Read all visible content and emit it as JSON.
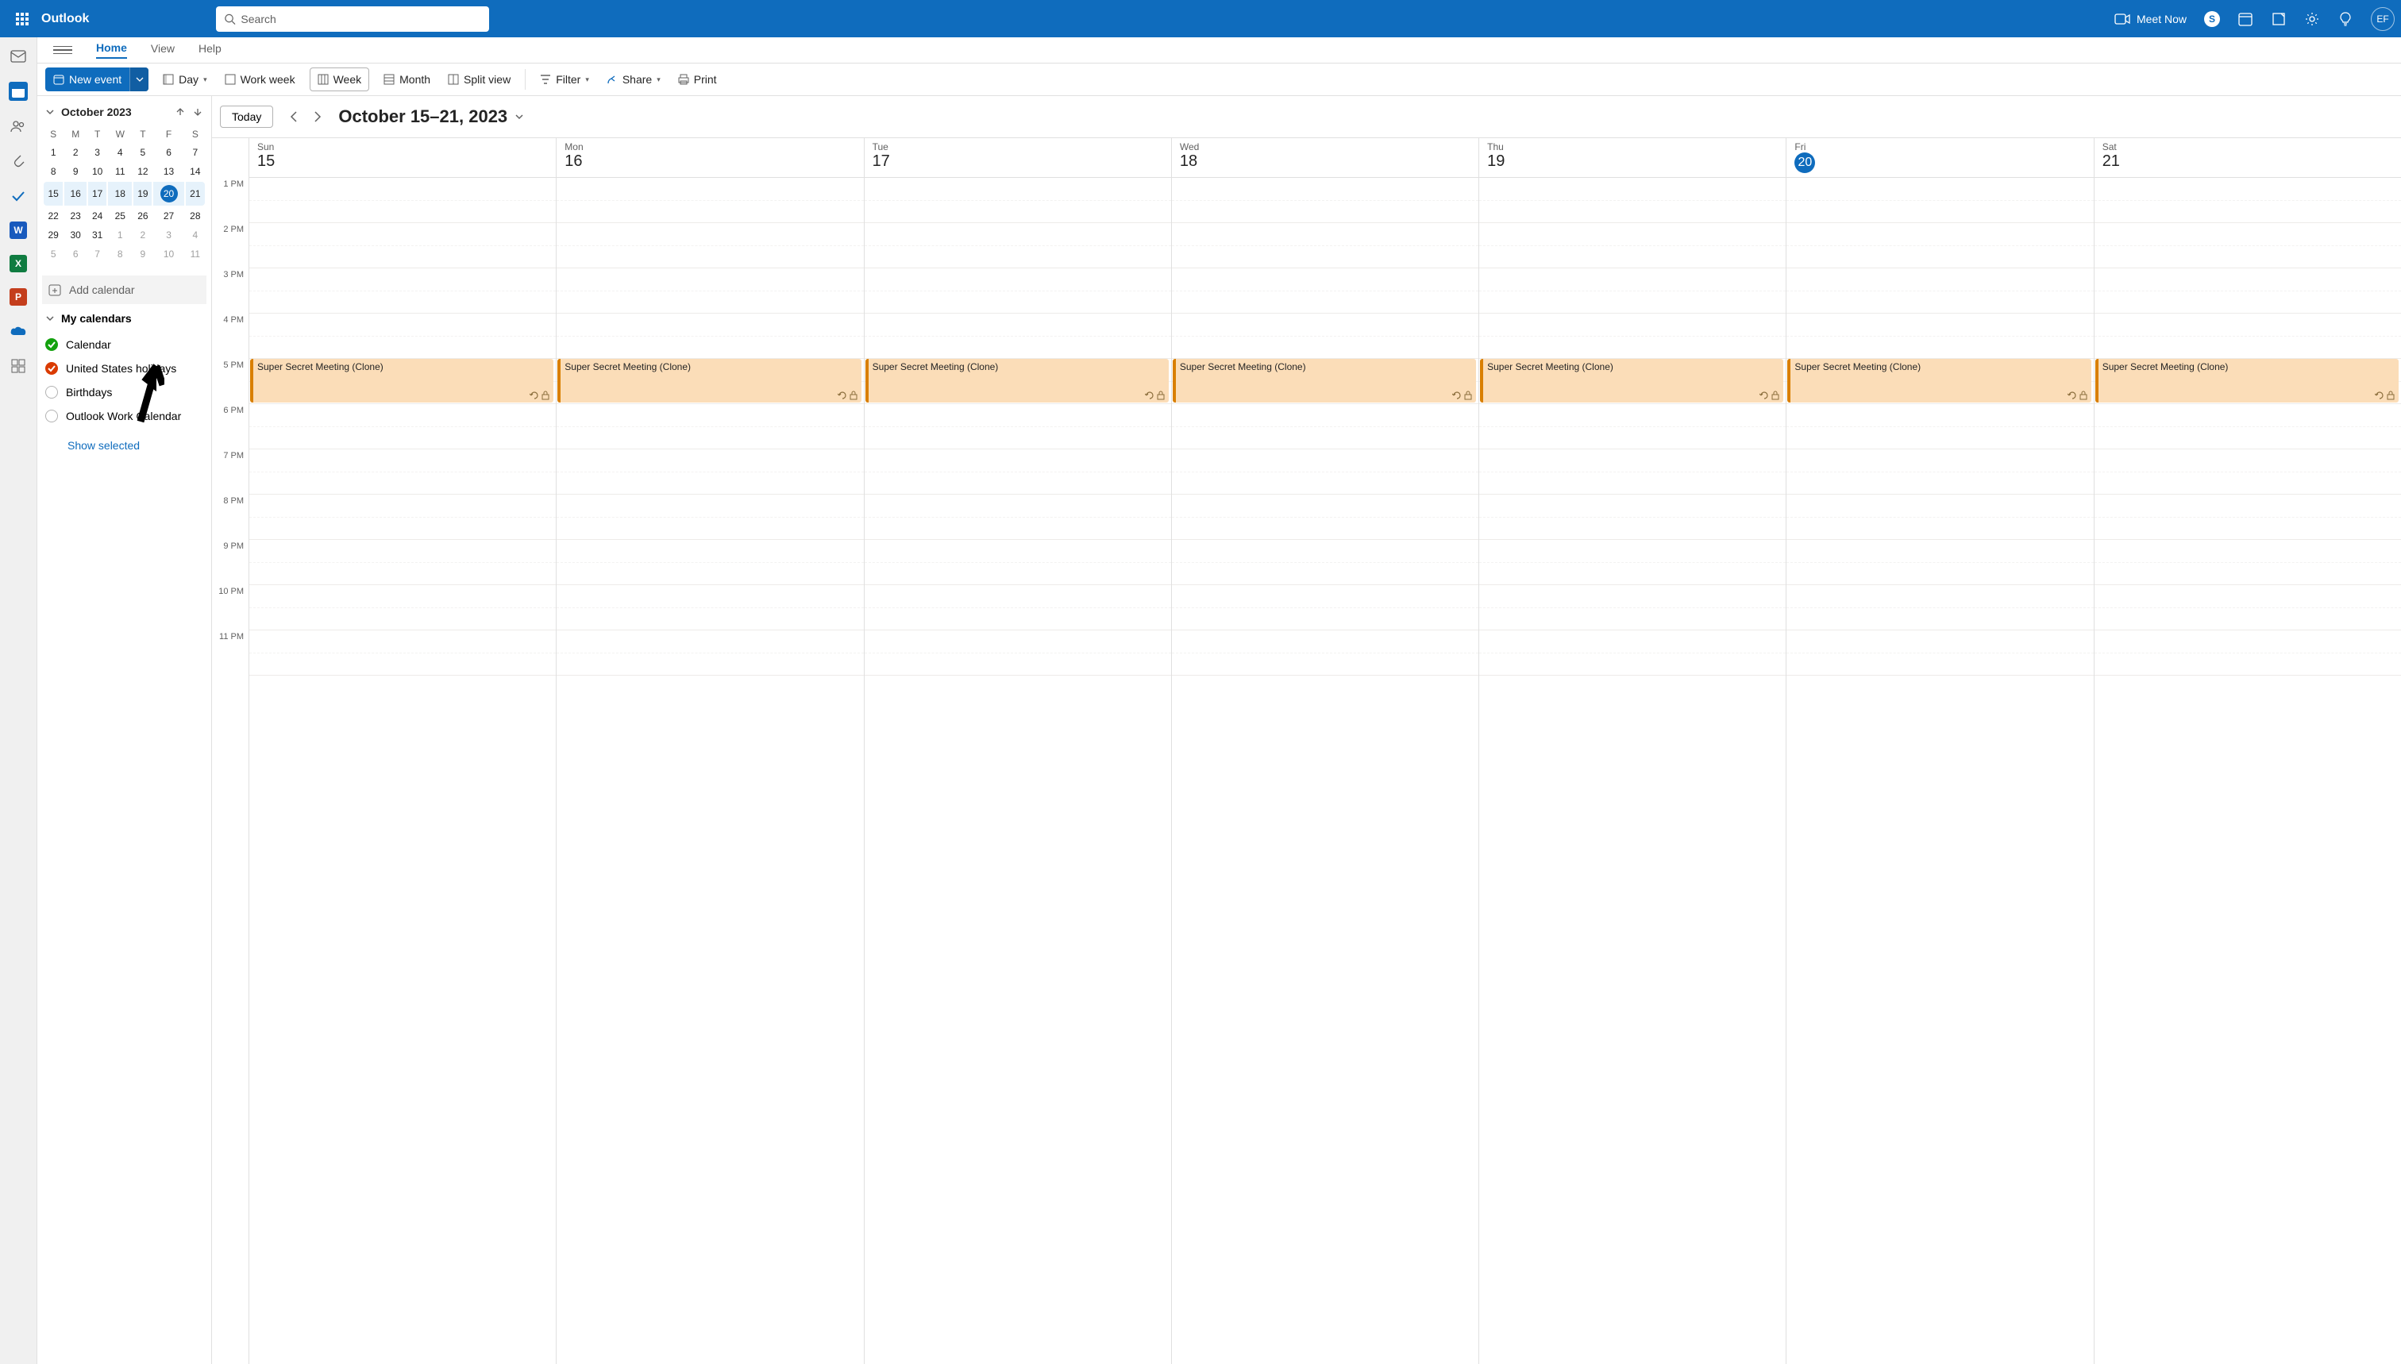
{
  "header": {
    "app_title": "Outlook",
    "search_placeholder": "Search",
    "meet_now": "Meet Now",
    "avatar_initials": "EF"
  },
  "tabs": {
    "home": "Home",
    "view": "View",
    "help": "Help"
  },
  "commands": {
    "new_event": "New event",
    "day": "Day",
    "work_week": "Work week",
    "week": "Week",
    "month": "Month",
    "split_view": "Split view",
    "filter": "Filter",
    "share": "Share",
    "print": "Print"
  },
  "sidebar": {
    "month_title": "October 2023",
    "weekdays": [
      "S",
      "M",
      "T",
      "W",
      "T",
      "F",
      "S"
    ],
    "rows": [
      {
        "cells": [
          "1",
          "2",
          "3",
          "4",
          "5",
          "6",
          "7"
        ],
        "hl": false
      },
      {
        "cells": [
          "8",
          "9",
          "10",
          "11",
          "12",
          "13",
          "14"
        ],
        "hl": false
      },
      {
        "cells": [
          "15",
          "16",
          "17",
          "18",
          "19",
          "20",
          "21"
        ],
        "hl": true,
        "today_idx": 5
      },
      {
        "cells": [
          "22",
          "23",
          "24",
          "25",
          "26",
          "27",
          "28"
        ],
        "hl": false
      },
      {
        "cells": [
          "29",
          "30",
          "31",
          "1",
          "2",
          "3",
          "4"
        ],
        "hl": false,
        "dim_from": 3
      },
      {
        "cells": [
          "5",
          "6",
          "7",
          "8",
          "9",
          "10",
          "11"
        ],
        "hl": false,
        "dim_from": 0
      }
    ],
    "add_calendar": "Add calendar",
    "my_calendars": "My calendars",
    "calendars": [
      {
        "label": "Calendar",
        "color": "#13A10E",
        "checked": true
      },
      {
        "label": "United States holidays",
        "color": "#DA3B01",
        "checked": true
      },
      {
        "label": "Birthdays",
        "color": "#ffffff",
        "checked": false
      },
      {
        "label": "Outlook Work Calendar",
        "color": "#ffffff",
        "checked": false
      }
    ],
    "show_selected": "Show selected"
  },
  "calendar": {
    "today": "Today",
    "date_range": "October 15–21, 2023",
    "days": [
      {
        "name": "Sun",
        "num": "15"
      },
      {
        "name": "Mon",
        "num": "16"
      },
      {
        "name": "Tue",
        "num": "17"
      },
      {
        "name": "Wed",
        "num": "18"
      },
      {
        "name": "Thu",
        "num": "19"
      },
      {
        "name": "Fri",
        "num": "20",
        "today": true
      },
      {
        "name": "Sat",
        "num": "21"
      }
    ],
    "hours": [
      "1 PM",
      "2 PM",
      "3 PM",
      "4 PM",
      "5 PM",
      "6 PM",
      "7 PM",
      "8 PM",
      "9 PM",
      "10 PM",
      "11 PM"
    ],
    "event_title": "Super Secret Meeting (Clone)"
  }
}
